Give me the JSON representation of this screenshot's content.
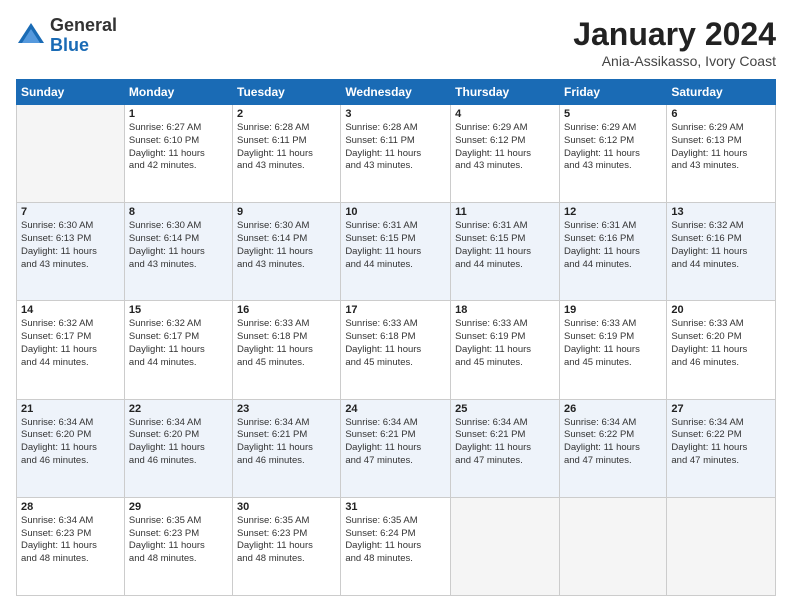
{
  "logo": {
    "general": "General",
    "blue": "Blue"
  },
  "header": {
    "month": "January 2024",
    "location": "Ania-Assikasso, Ivory Coast"
  },
  "weekdays": [
    "Sunday",
    "Monday",
    "Tuesday",
    "Wednesday",
    "Thursday",
    "Friday",
    "Saturday"
  ],
  "weeks": [
    [
      {
        "day": "",
        "empty": true
      },
      {
        "day": "1",
        "sunrise": "6:27 AM",
        "sunset": "6:10 PM",
        "daylight": "11 hours and 42 minutes."
      },
      {
        "day": "2",
        "sunrise": "6:28 AM",
        "sunset": "6:11 PM",
        "daylight": "11 hours and 43 minutes."
      },
      {
        "day": "3",
        "sunrise": "6:28 AM",
        "sunset": "6:11 PM",
        "daylight": "11 hours and 43 minutes."
      },
      {
        "day": "4",
        "sunrise": "6:29 AM",
        "sunset": "6:12 PM",
        "daylight": "11 hours and 43 minutes."
      },
      {
        "day": "5",
        "sunrise": "6:29 AM",
        "sunset": "6:12 PM",
        "daylight": "11 hours and 43 minutes."
      },
      {
        "day": "6",
        "sunrise": "6:29 AM",
        "sunset": "6:13 PM",
        "daylight": "11 hours and 43 minutes."
      }
    ],
    [
      {
        "day": "7",
        "sunrise": "6:30 AM",
        "sunset": "6:13 PM",
        "daylight": "11 hours and 43 minutes."
      },
      {
        "day": "8",
        "sunrise": "6:30 AM",
        "sunset": "6:14 PM",
        "daylight": "11 hours and 43 minutes."
      },
      {
        "day": "9",
        "sunrise": "6:30 AM",
        "sunset": "6:14 PM",
        "daylight": "11 hours and 43 minutes."
      },
      {
        "day": "10",
        "sunrise": "6:31 AM",
        "sunset": "6:15 PM",
        "daylight": "11 hours and 44 minutes."
      },
      {
        "day": "11",
        "sunrise": "6:31 AM",
        "sunset": "6:15 PM",
        "daylight": "11 hours and 44 minutes."
      },
      {
        "day": "12",
        "sunrise": "6:31 AM",
        "sunset": "6:16 PM",
        "daylight": "11 hours and 44 minutes."
      },
      {
        "day": "13",
        "sunrise": "6:32 AM",
        "sunset": "6:16 PM",
        "daylight": "11 hours and 44 minutes."
      }
    ],
    [
      {
        "day": "14",
        "sunrise": "6:32 AM",
        "sunset": "6:17 PM",
        "daylight": "11 hours and 44 minutes."
      },
      {
        "day": "15",
        "sunrise": "6:32 AM",
        "sunset": "6:17 PM",
        "daylight": "11 hours and 44 minutes."
      },
      {
        "day": "16",
        "sunrise": "6:33 AM",
        "sunset": "6:18 PM",
        "daylight": "11 hours and 45 minutes."
      },
      {
        "day": "17",
        "sunrise": "6:33 AM",
        "sunset": "6:18 PM",
        "daylight": "11 hours and 45 minutes."
      },
      {
        "day": "18",
        "sunrise": "6:33 AM",
        "sunset": "6:19 PM",
        "daylight": "11 hours and 45 minutes."
      },
      {
        "day": "19",
        "sunrise": "6:33 AM",
        "sunset": "6:19 PM",
        "daylight": "11 hours and 45 minutes."
      },
      {
        "day": "20",
        "sunrise": "6:33 AM",
        "sunset": "6:20 PM",
        "daylight": "11 hours and 46 minutes."
      }
    ],
    [
      {
        "day": "21",
        "sunrise": "6:34 AM",
        "sunset": "6:20 PM",
        "daylight": "11 hours and 46 minutes."
      },
      {
        "day": "22",
        "sunrise": "6:34 AM",
        "sunset": "6:20 PM",
        "daylight": "11 hours and 46 minutes."
      },
      {
        "day": "23",
        "sunrise": "6:34 AM",
        "sunset": "6:21 PM",
        "daylight": "11 hours and 46 minutes."
      },
      {
        "day": "24",
        "sunrise": "6:34 AM",
        "sunset": "6:21 PM",
        "daylight": "11 hours and 47 minutes."
      },
      {
        "day": "25",
        "sunrise": "6:34 AM",
        "sunset": "6:21 PM",
        "daylight": "11 hours and 47 minutes."
      },
      {
        "day": "26",
        "sunrise": "6:34 AM",
        "sunset": "6:22 PM",
        "daylight": "11 hours and 47 minutes."
      },
      {
        "day": "27",
        "sunrise": "6:34 AM",
        "sunset": "6:22 PM",
        "daylight": "11 hours and 47 minutes."
      }
    ],
    [
      {
        "day": "28",
        "sunrise": "6:34 AM",
        "sunset": "6:23 PM",
        "daylight": "11 hours and 48 minutes."
      },
      {
        "day": "29",
        "sunrise": "6:35 AM",
        "sunset": "6:23 PM",
        "daylight": "11 hours and 48 minutes."
      },
      {
        "day": "30",
        "sunrise": "6:35 AM",
        "sunset": "6:23 PM",
        "daylight": "11 hours and 48 minutes."
      },
      {
        "day": "31",
        "sunrise": "6:35 AM",
        "sunset": "6:24 PM",
        "daylight": "11 hours and 48 minutes."
      },
      {
        "day": "",
        "empty": true
      },
      {
        "day": "",
        "empty": true
      },
      {
        "day": "",
        "empty": true
      }
    ]
  ],
  "labels": {
    "sunrise": "Sunrise:",
    "sunset": "Sunset:",
    "daylight": "Daylight:"
  }
}
